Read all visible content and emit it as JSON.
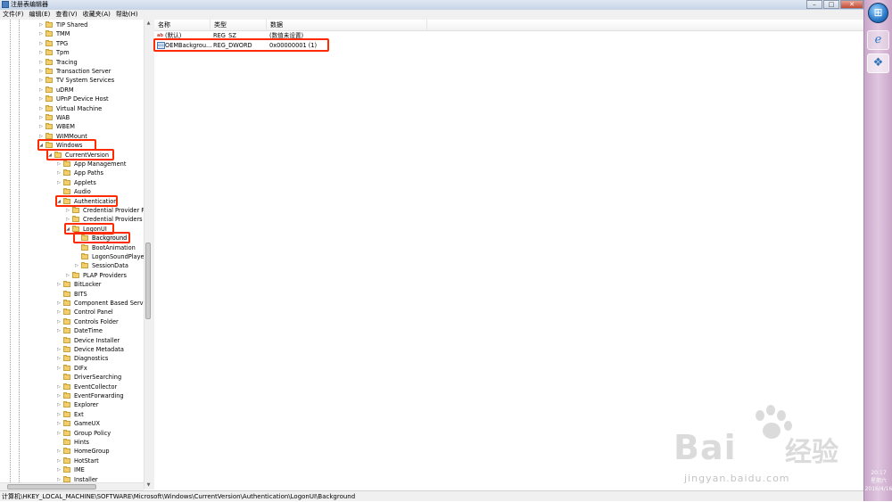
{
  "window": {
    "title": "注册表编辑器"
  },
  "menu": [
    "文件(F)",
    "编辑(E)",
    "查看(V)",
    "收藏夹(A)",
    "帮助(H)"
  ],
  "tree": [
    {
      "label": "TIP Shared",
      "depth": 2,
      "exp": "▷"
    },
    {
      "label": "TMM",
      "depth": 2,
      "exp": "▷"
    },
    {
      "label": "TPG",
      "depth": 2,
      "exp": "▷"
    },
    {
      "label": "Tpm",
      "depth": 2,
      "exp": "▷"
    },
    {
      "label": "Tracing",
      "depth": 2,
      "exp": "▷"
    },
    {
      "label": "Transaction Server",
      "depth": 2,
      "exp": "▷"
    },
    {
      "label": "TV System Services",
      "depth": 2,
      "exp": "▷"
    },
    {
      "label": "uDRM",
      "depth": 2,
      "exp": "▷"
    },
    {
      "label": "UPnP Device Host",
      "depth": 2,
      "exp": "▷"
    },
    {
      "label": "Virtual Machine",
      "depth": 2,
      "exp": "▷"
    },
    {
      "label": "WAB",
      "depth": 2,
      "exp": "▷"
    },
    {
      "label": "WBEM",
      "depth": 2,
      "exp": "▷"
    },
    {
      "label": "WIMMount",
      "depth": 2,
      "exp": "▷"
    },
    {
      "label": "Windows",
      "depth": 2,
      "exp": "◢"
    },
    {
      "label": "CurrentVersion",
      "depth": 3,
      "exp": "◢"
    },
    {
      "label": "App Management",
      "depth": 4,
      "exp": "▷"
    },
    {
      "label": "App Paths",
      "depth": 4,
      "exp": "▷"
    },
    {
      "label": "Applets",
      "depth": 4,
      "exp": "▷"
    },
    {
      "label": "Audio",
      "depth": 4,
      "exp": ""
    },
    {
      "label": "Authentication",
      "depth": 4,
      "exp": "◢"
    },
    {
      "label": "Credential Provider Filt",
      "depth": 5,
      "exp": "▷"
    },
    {
      "label": "Credential Providers",
      "depth": 5,
      "exp": "▷"
    },
    {
      "label": "LogonUI",
      "depth": 5,
      "exp": "◢"
    },
    {
      "label": "Background",
      "depth": 6,
      "exp": "",
      "selected": true
    },
    {
      "label": "BootAnimation",
      "depth": 6,
      "exp": ""
    },
    {
      "label": "LogonSoundPlayed",
      "depth": 6,
      "exp": ""
    },
    {
      "label": "SessionData",
      "depth": 6,
      "exp": "▷"
    },
    {
      "label": "PLAP Providers",
      "depth": 5,
      "exp": "▷"
    },
    {
      "label": "BitLocker",
      "depth": 4,
      "exp": "▷"
    },
    {
      "label": "BITS",
      "depth": 4,
      "exp": ""
    },
    {
      "label": "Component Based Servici",
      "depth": 4,
      "exp": "▷"
    },
    {
      "label": "Control Panel",
      "depth": 4,
      "exp": "▷"
    },
    {
      "label": "Controls Folder",
      "depth": 4,
      "exp": "▷"
    },
    {
      "label": "DateTime",
      "depth": 4,
      "exp": "▷"
    },
    {
      "label": "Device Installer",
      "depth": 4,
      "exp": ""
    },
    {
      "label": "Device Metadata",
      "depth": 4,
      "exp": "▷"
    },
    {
      "label": "Diagnostics",
      "depth": 4,
      "exp": "▷"
    },
    {
      "label": "DIFx",
      "depth": 4,
      "exp": "▷"
    },
    {
      "label": "DriverSearching",
      "depth": 4,
      "exp": ""
    },
    {
      "label": "EventCollector",
      "depth": 4,
      "exp": "▷"
    },
    {
      "label": "EventForwarding",
      "depth": 4,
      "exp": "▷"
    },
    {
      "label": "Explorer",
      "depth": 4,
      "exp": "▷"
    },
    {
      "label": "Ext",
      "depth": 4,
      "exp": "▷"
    },
    {
      "label": "GameUX",
      "depth": 4,
      "exp": "▷"
    },
    {
      "label": "Group Policy",
      "depth": 4,
      "exp": "▷"
    },
    {
      "label": "Hints",
      "depth": 4,
      "exp": ""
    },
    {
      "label": "HomeGroup",
      "depth": 4,
      "exp": "▷"
    },
    {
      "label": "HotStart",
      "depth": 4,
      "exp": "▷"
    },
    {
      "label": "IME",
      "depth": 4,
      "exp": "▷"
    },
    {
      "label": "Installer",
      "depth": 4,
      "exp": "▷"
    }
  ],
  "columns": {
    "name": "名称",
    "type": "类型",
    "data": "数据"
  },
  "values": [
    {
      "icon": "ab",
      "name": "(默认)",
      "type": "REG_SZ",
      "data": "(数值未设置)"
    },
    {
      "icon": "bin",
      "name": "OEMBackgrou...",
      "type": "REG_DWORD",
      "data": "0x00000001 (1)"
    }
  ],
  "status": "计算机\\HKEY_LOCAL_MACHINE\\SOFTWARE\\Microsoft\\Windows\\CurrentVersion\\Authentication\\LogonUI\\Background",
  "taskbar": {
    "time": "20:17",
    "weekday": "星期六",
    "date": "2016/4/16"
  },
  "watermark": {
    "brand": "Bai",
    "brand2": "经验",
    "url": "jingyan.baidu.com"
  },
  "colors": {
    "highlight": "#ff2a00",
    "folder": "#f2cf6a"
  }
}
